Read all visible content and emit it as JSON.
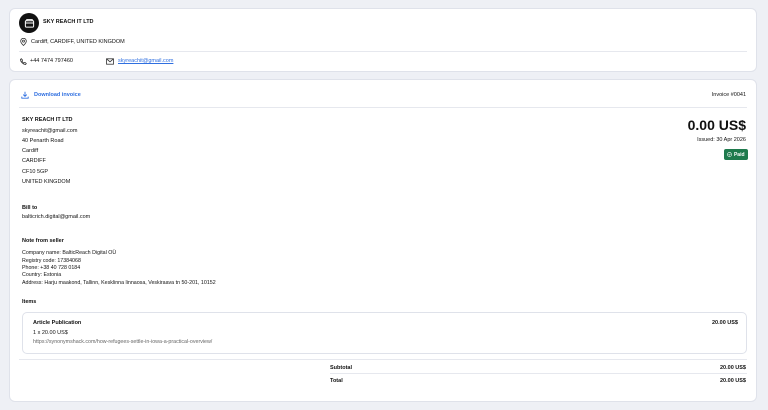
{
  "seller_card": {
    "name": "SKY REACH IT LTD",
    "location": "Cardiff, CARDIFF, UNITED KINGDOM",
    "phone": "+44 7474 797460",
    "email": "skyreachit@gmail.com"
  },
  "invoice": {
    "download_label": "Download invoice",
    "invoice_number": "Invoice #0041",
    "amount": "0.00 US$",
    "issued": "Issued: 30 Apr 2026",
    "status": "Paid",
    "seller": {
      "name": "SKY REACH IT LTD",
      "lines": [
        "skyreachit@gmail.com",
        "40 Penarth Road",
        "Cardiff",
        "CARDIFF",
        "CF10 5GP",
        "UNITED KINGDOM"
      ]
    },
    "bill_to": {
      "heading": "Bill to",
      "email": "balticrich.digital@gmail.com"
    },
    "note": {
      "heading": "Note from seller",
      "lines": [
        "Company name: BalticReach Digital OÜ",
        "Registry code: 17384068",
        "Phone: +38 40 728 0184",
        "Country: Estonia",
        "Address: Harju maakond, Tallinn, Kesklinna linnaosa, Veskiraava tn 50-201, 10152"
      ]
    },
    "items_heading": "Items",
    "items": [
      {
        "title": "Article Publication",
        "qty_price": "1 x 20.00 US$",
        "url": "https://synonymshack.com/how-refugees-settle-in-iowa-a-practical-overview/",
        "amount": "20.00 US$"
      }
    ],
    "subtotal_label": "Subtotal",
    "subtotal_value": "20.00 US$",
    "total_label": "Total",
    "total_value": "20.00 US$"
  }
}
